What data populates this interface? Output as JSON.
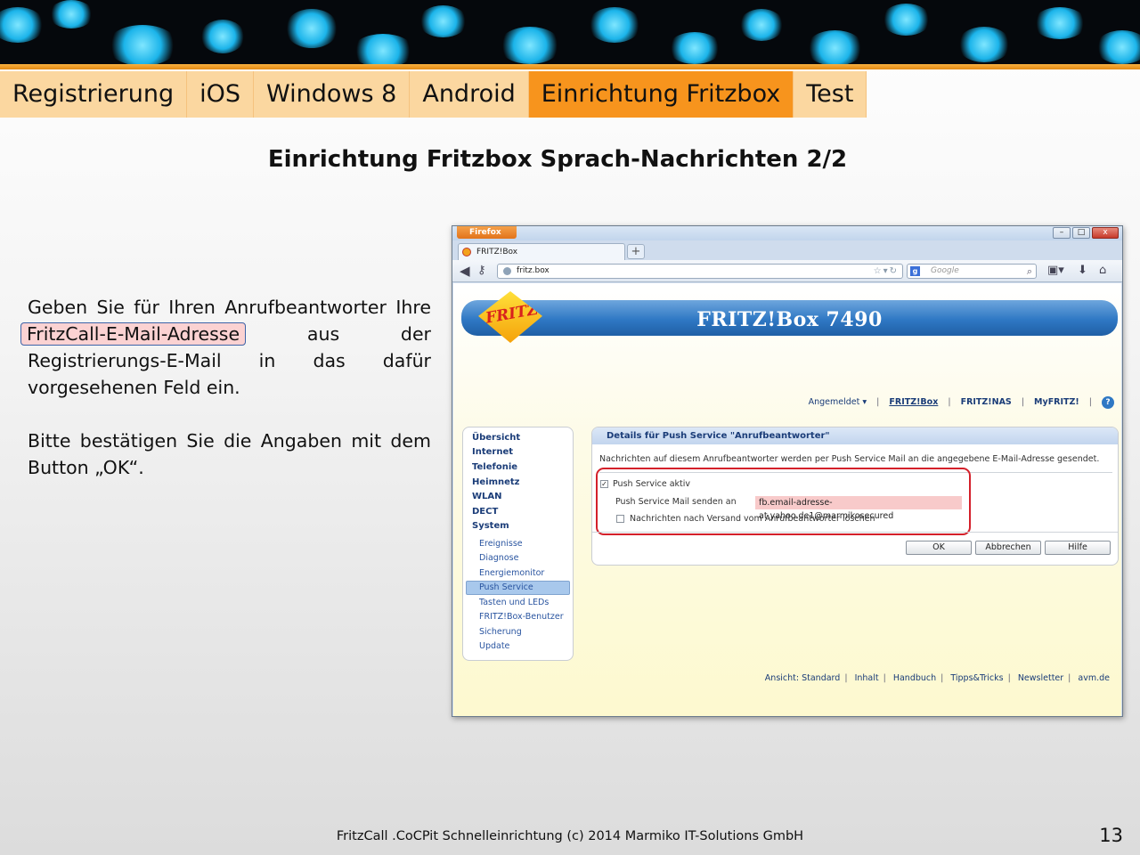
{
  "tabs": [
    {
      "label": "Registrierung",
      "active": false
    },
    {
      "label": "iOS",
      "active": false
    },
    {
      "label": "Windows 8",
      "active": false
    },
    {
      "label": "Android",
      "active": false
    },
    {
      "label": "Einrichtung Fritzbox",
      "active": true
    },
    {
      "label": "Test",
      "active": false
    }
  ],
  "colors": {
    "tab": "#fbd7a0",
    "tab_active": "#f7941d",
    "highlight_frame": "#d4202a"
  },
  "title": "Einrichtung Fritzbox Sprach-Nachrichten 2/2",
  "instructions": {
    "p1_start": "Geben Sie für Ihren Anrufbeantworter Ihre",
    "p1_highlight": "FritzCall-E-Mail-Adresse",
    "p1_end": "aus der Registrierungs-E-Mail in das dafür vorgesehenen Feld ein.",
    "p2": "Bitte bestätigen Sie die Angaben mit dem Button „OK“."
  },
  "browser": {
    "menu_button": "Firefox",
    "tab_title": "FRITZ!Box",
    "new_tab": "+",
    "url": "fritz.box",
    "search_placeholder": "Google",
    "window_controls": [
      "–",
      "□",
      "x"
    ]
  },
  "fritzbox": {
    "logo": "FRITZ!",
    "model": "FRITZ!Box 7490",
    "top_nav": [
      "Angemeldet ▾",
      "FRITZ!Box",
      "FRITZ!NAS",
      "MyFRITZ!"
    ],
    "sidebar_main": [
      "Übersicht",
      "Internet",
      "Telefonie",
      "Heimnetz",
      "WLAN",
      "DECT",
      "System"
    ],
    "sidebar_sub": [
      "Ereignisse",
      "Diagnose",
      "Energiemonitor",
      "Push Service",
      "Tasten und LEDs",
      "FRITZ!Box-Benutzer",
      "Sicherung",
      "Update"
    ],
    "sidebar_selected": "Push Service",
    "panel_title": "Details für Push Service \"Anrufbeantworter\"",
    "panel_desc": "Nachrichten auf diesem Anrufbeantworter werden per Push Service Mail an die angegebene E-Mail-Adresse gesendet.",
    "push_active_label": "Push Service aktiv",
    "push_active_checked": true,
    "send_to_label": "Push Service Mail senden an",
    "email_value": "fb.email-adresse-at.yahoo.de1@marmikosecured",
    "delete_label": "Nachrichten nach Versand vom Anrufbeantworter löschen",
    "delete_checked": false,
    "buttons": {
      "ok": "OK",
      "cancel": "Abbrechen",
      "help": "Hilfe"
    },
    "footer_links": [
      "Ansicht: Standard",
      "Inhalt",
      "Handbuch",
      "Tipps&Tricks",
      "Newsletter",
      "avm.de"
    ]
  },
  "footer": "FritzCall .CoCPit Schnelleinrichtung (c) 2014 Marmiko IT-Solutions GmbH",
  "page_number": "13"
}
